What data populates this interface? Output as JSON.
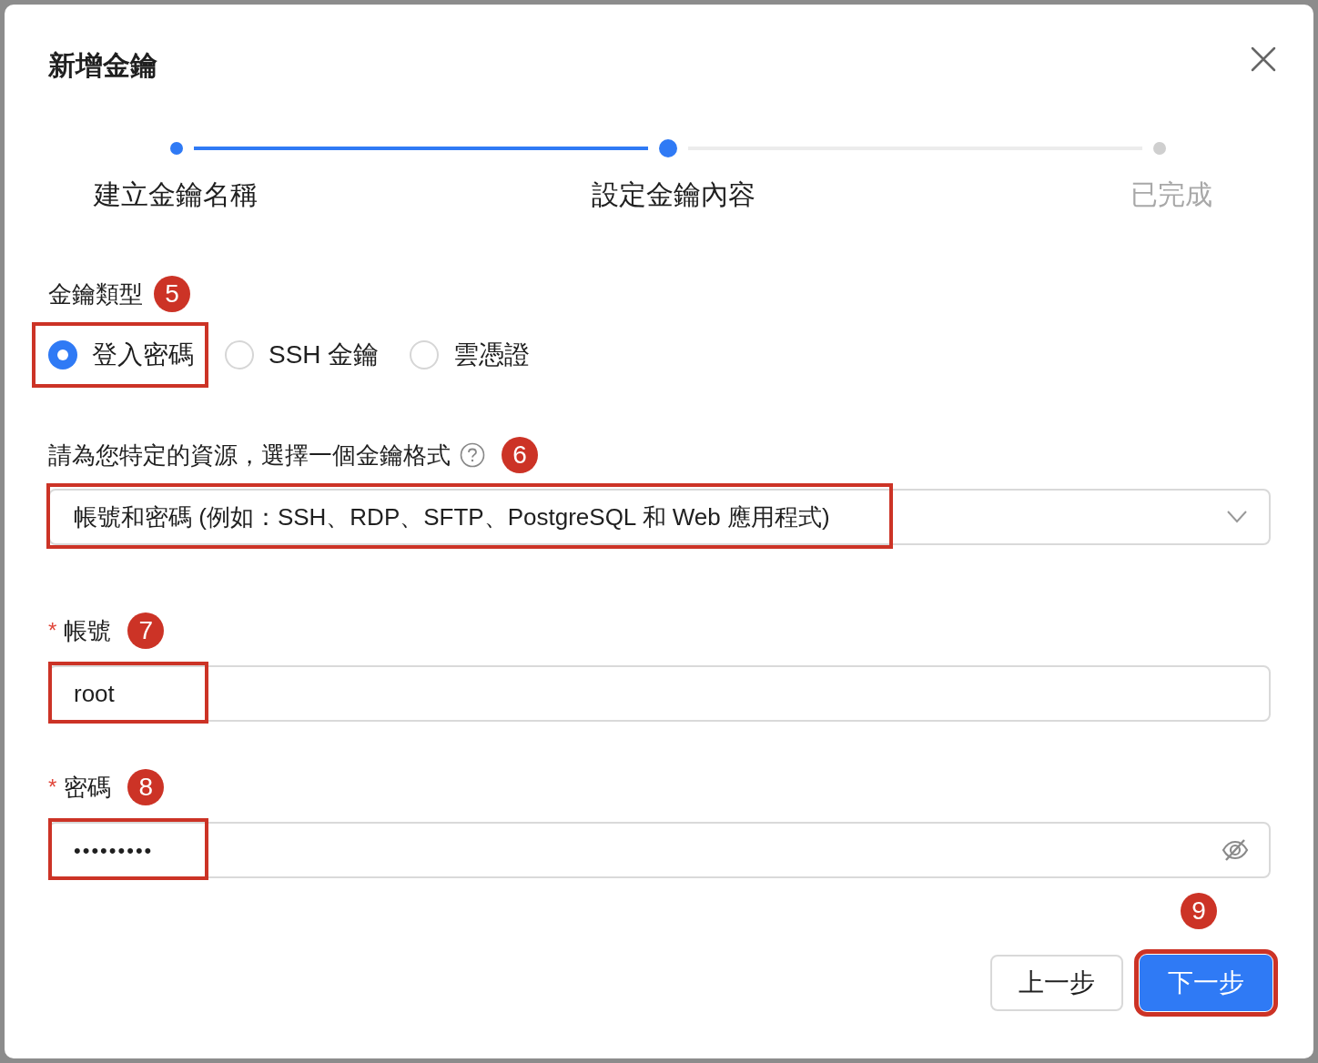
{
  "dialog": {
    "title": "新增金鑰"
  },
  "steps": [
    {
      "label": "建立金鑰名稱",
      "completed": true,
      "selected": false
    },
    {
      "label": "設定金鑰內容",
      "completed": false,
      "selected": true
    },
    {
      "label": "已完成",
      "completed": false,
      "selected": false
    }
  ],
  "key_type": {
    "label": "金鑰類型",
    "badge": "5",
    "options": [
      {
        "label": "登入密碼",
        "selected": true,
        "highlighted": true
      },
      {
        "label": "SSH 金鑰",
        "selected": false,
        "highlighted": false
      },
      {
        "label": "雲憑證",
        "selected": false,
        "highlighted": false
      }
    ]
  },
  "format": {
    "label": "請為您特定的資源，選擇一個金鑰格式",
    "badge": "6",
    "value": "帳號和密碼 (例如：SSH、RDP、SFTP、PostgreSQL 和 Web 應用程式)",
    "highlighted": true
  },
  "fields": [
    {
      "label": "帳號",
      "required_mark": "*",
      "badge": "7",
      "value": "root",
      "kind": "text",
      "highlighted": true
    },
    {
      "label": "密碼",
      "required_mark": "*",
      "badge": "8",
      "value": "•••••••••",
      "kind": "password",
      "highlighted": true
    }
  ],
  "buttons": [
    {
      "label": "上一步",
      "kind": "secondary",
      "highlighted": false
    },
    {
      "label": "下一步",
      "kind": "primary",
      "badge": "9",
      "highlighted": true
    }
  ]
}
